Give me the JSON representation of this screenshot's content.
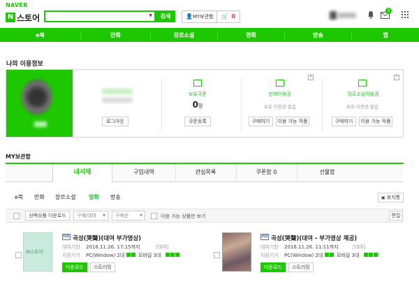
{
  "header": {
    "naver": "NAVER",
    "logo_n": "N",
    "logo_text": "스토어",
    "search_button": "검색",
    "library_button": "MY보관함",
    "cart_count": "0",
    "mail_badge": "3"
  },
  "nav": {
    "items": [
      "e북",
      "만화",
      "장르소설",
      "영화",
      "방송",
      "앱"
    ]
  },
  "usage": {
    "title": "나의 이용정보",
    "logout_button": "로그아웃",
    "coupon": {
      "title": "보유쿠폰",
      "count": "0",
      "unit": "장",
      "register_button": "쿠폰등록"
    },
    "comic": {
      "title": "만화이용권",
      "status": "보유 이용권 없음",
      "buy_button": "구매하기",
      "available_button": "이용 가능 작품",
      "help": "?"
    },
    "genre": {
      "title": "장르소설이용권",
      "status": "보유 이용권 없음",
      "buy_button": "구매하기",
      "available_button": "이용 가능 작품",
      "help": "?"
    }
  },
  "library": {
    "title": "MY보관함",
    "tabs": [
      "내서재",
      "구입내역",
      "관심목록",
      "쿠폰함 0",
      "선물함"
    ],
    "categories": [
      "e북",
      "만화",
      "장르소설",
      "영화",
      "방송"
    ],
    "trash_button": "휴지통",
    "download_selected": "선택상품 다운로드",
    "filter_type": "구매/대여",
    "filter_sort": "구매순",
    "available_only": "이용 가능 상품만 보기",
    "edit_button": "편집"
  },
  "items": [
    {
      "hd": "HD",
      "title": "곡성(哭聲)(대여 부가영상)",
      "period_label": "대여기한",
      "period_value": "2016.11.26. 17:15까지",
      "period_tag": "[대여]",
      "device_label": "지원기기",
      "device_value": "PC(Window) 2대",
      "mobile_value": "모바일 3대",
      "download_button": "다운로드",
      "stream_button": "스트리밍",
      "thumb_text": "N스토어"
    },
    {
      "hd": "HD",
      "title": "곡성(哭聲)(대여 - 부가영상 제공)",
      "period_label": "대여기한",
      "period_value": "2016.11.26. 11:11까지",
      "period_tag": "[대여]",
      "device_label": "지원기기",
      "device_value": "PC(Window) 2대",
      "mobile_value": "모바일 3대",
      "download_button": "다운로드",
      "stream_button": "스트리밍"
    }
  ],
  "colors": {
    "brand": "#1ec800",
    "nav_bg": "#1ec800"
  }
}
